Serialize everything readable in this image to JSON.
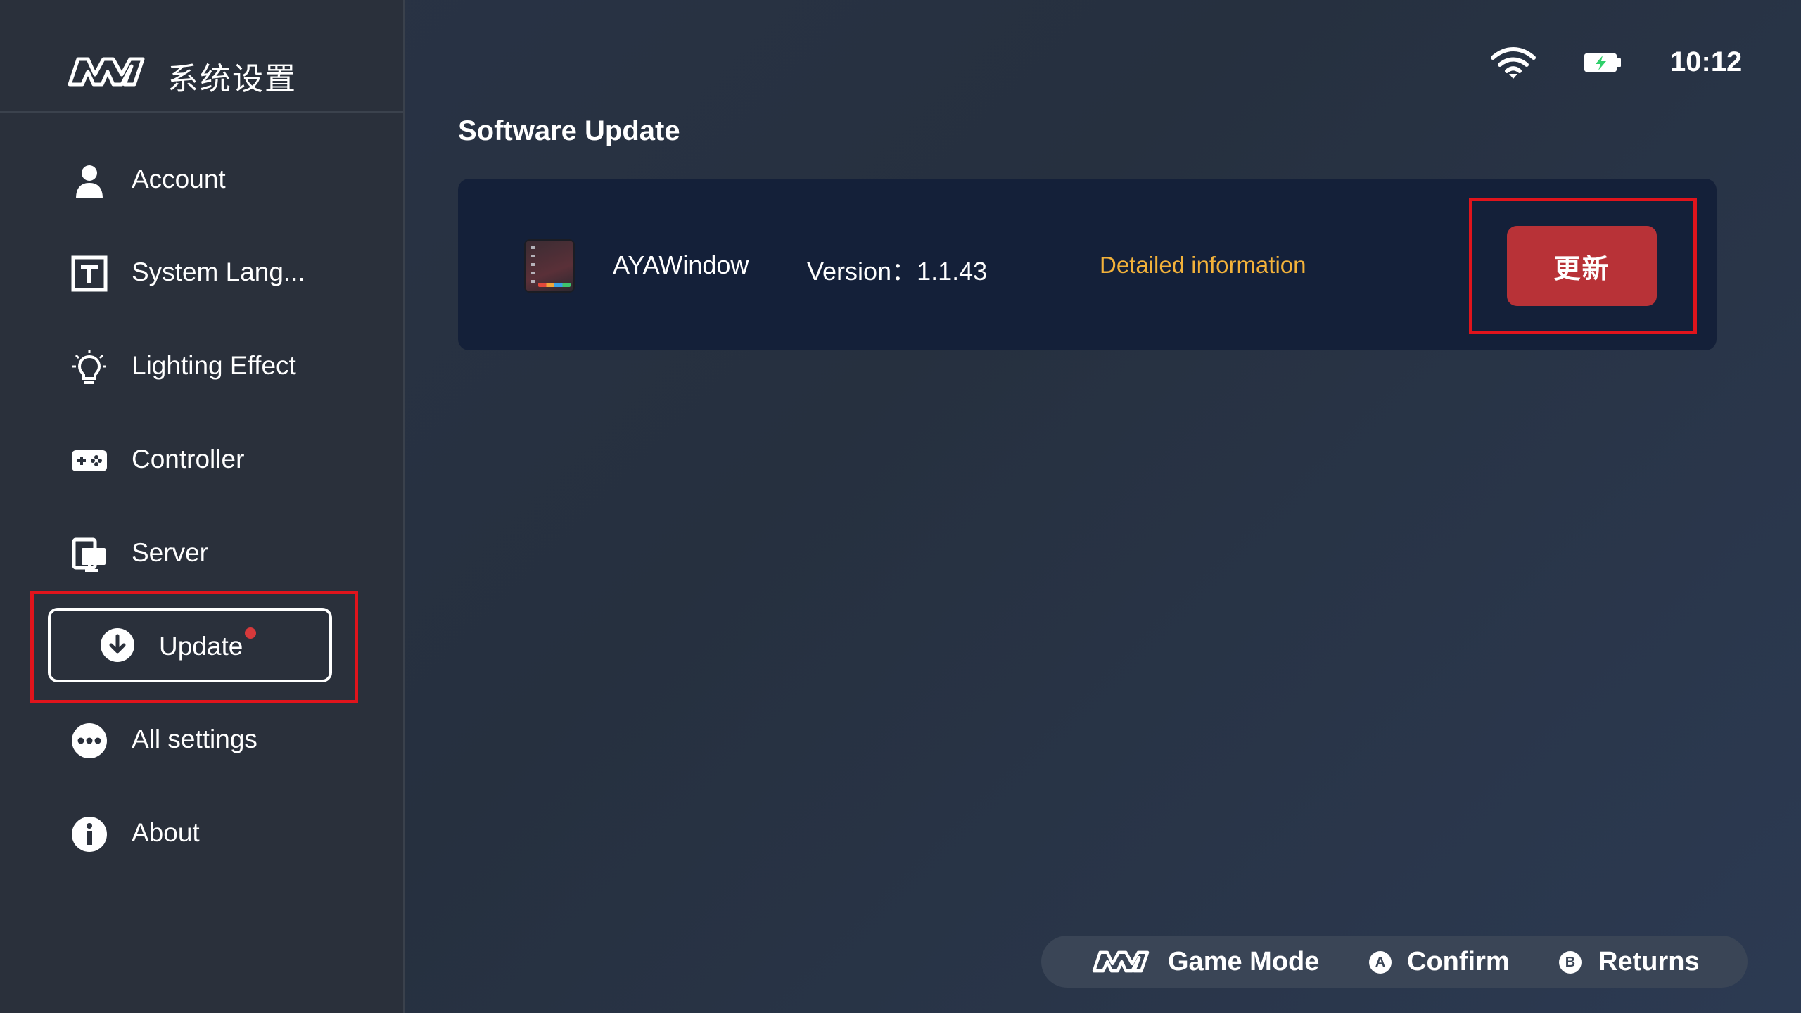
{
  "app": {
    "title": "系统设置",
    "logo": "aya-logo"
  },
  "status": {
    "time": "10:12",
    "wifi_icon": "wifi-icon",
    "battery_icon": "battery-charging-icon"
  },
  "sidebar": {
    "items": [
      {
        "label": "Account",
        "icon": "person-icon"
      },
      {
        "label": "System Lang...",
        "icon": "text-icon"
      },
      {
        "label": "Lighting Effect",
        "icon": "lightbulb-icon"
      },
      {
        "label": "Controller",
        "icon": "gamepad-icon"
      },
      {
        "label": "Server",
        "icon": "server-icon"
      },
      {
        "label": "Update",
        "icon": "download-circle-icon",
        "selected": true,
        "has_badge": true
      },
      {
        "label": "All settings",
        "icon": "more-circle-icon"
      },
      {
        "label": "About",
        "icon": "info-circle-icon"
      }
    ]
  },
  "main": {
    "section_title": "Software Update",
    "update_entry": {
      "app_name": "AYAWindow",
      "version": "Version：1.1.43",
      "details_link": "Detailed information",
      "action_label": "更新"
    }
  },
  "hints": {
    "game_mode": "Game Mode",
    "confirm_button": "A",
    "confirm": "Confirm",
    "returns_button": "B",
    "returns": "Returns"
  },
  "colors": {
    "accent_red": "#b83237",
    "highlight_red": "#e0141c",
    "link_yellow": "#f3b23a",
    "card_bg": "#142039",
    "sidebar_bg": "#2a303b"
  }
}
